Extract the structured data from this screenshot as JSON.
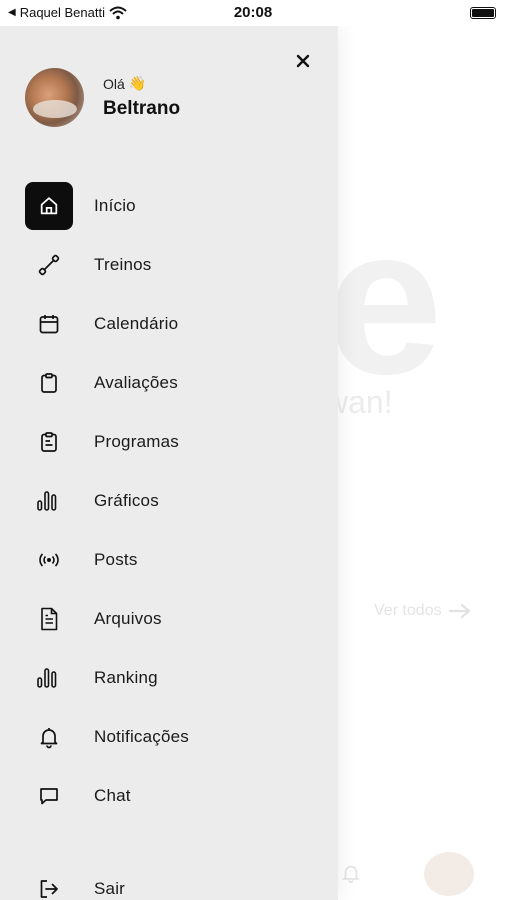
{
  "status_bar": {
    "back_label": "Raquel Benatti",
    "time": "20:08"
  },
  "background": {
    "logo_letter": "e",
    "tagline_fragment": "wan!",
    "see_all": "Ver todos"
  },
  "drawer": {
    "greeting": "Olá",
    "greeting_emoji": "👋",
    "user_name": "Beltrano",
    "items": [
      {
        "label": "Início",
        "icon": "home-icon",
        "active": true
      },
      {
        "label": "Treinos",
        "icon": "dumbbell-icon",
        "active": false
      },
      {
        "label": "Calendário",
        "icon": "calendar-icon",
        "active": false
      },
      {
        "label": "Avaliações",
        "icon": "clipboard-icon",
        "active": false
      },
      {
        "label": "Programas",
        "icon": "clipboard-list-icon",
        "active": false
      },
      {
        "label": "Gráficos",
        "icon": "bar-chart-icon",
        "active": false
      },
      {
        "label": "Posts",
        "icon": "broadcast-icon",
        "active": false
      },
      {
        "label": "Arquivos",
        "icon": "file-icon",
        "active": false
      },
      {
        "label": "Ranking",
        "icon": "ranking-icon",
        "active": false
      },
      {
        "label": "Notificações",
        "icon": "bell-icon",
        "active": false
      },
      {
        "label": "Chat",
        "icon": "chat-icon",
        "active": false
      },
      {
        "label": "Sair",
        "icon": "logout-icon",
        "active": false
      }
    ]
  }
}
